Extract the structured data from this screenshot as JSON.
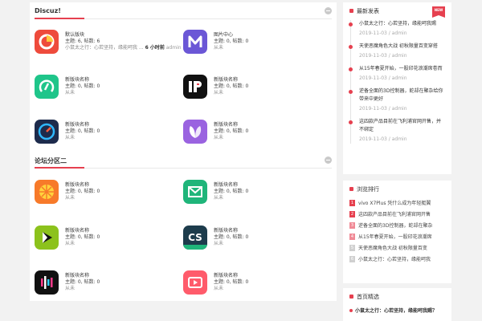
{
  "sections": [
    {
      "title": "Discuz!",
      "forums": [
        {
          "name": "默认版块",
          "stats": "主题: 6, 帖数: 6",
          "last_title": "小鼠太之行：心若坚持，缘能呵我 ...",
          "last_time": "6 小时前",
          "last_user": "admin",
          "icon": "target-icon",
          "color": "#ee4b3c"
        },
        {
          "name": "图片中心",
          "stats": "主题: 0, 帖数: 0",
          "last": "从未",
          "icon": "letter-m-icon",
          "color": "#6b57d6"
        },
        {
          "name": "新版块名称",
          "stats": "主题: 0, 帖数: 0",
          "last": "从未",
          "icon": "timer-icon",
          "color": "#1fc58a"
        },
        {
          "name": "新版块名称",
          "stats": "主题: 0, 帖数: 0",
          "last": "从未",
          "icon": "ip-logo-icon",
          "color": "#111111"
        },
        {
          "name": "新版块名称",
          "stats": "主题: 0, 帖数: 0",
          "last": "从未",
          "icon": "speedometer-icon",
          "color": "#1d2b4c"
        },
        {
          "name": "新版块名称",
          "stats": "主题: 0, 帖数: 0",
          "last": "从未",
          "icon": "leaf-icon",
          "color": "#9a63e0"
        }
      ]
    },
    {
      "title": "论坛分区二",
      "forums": [
        {
          "name": "新版块名称",
          "stats": "主题: 0, 帖数: 0",
          "last": "从未",
          "icon": "orange-slice-icon",
          "color": "#f77a2a"
        },
        {
          "name": "新版块名称",
          "stats": "主题: 0, 帖数: 0",
          "last": "从未",
          "icon": "mail-icon",
          "color": "#1fb57a"
        },
        {
          "name": "新版块名称",
          "stats": "主题: 0, 帖数: 0",
          "last": "从未",
          "icon": "play-icon",
          "color": "#8cc21c"
        },
        {
          "name": "新版块名称",
          "stats": "主题: 0, 帖数: 0",
          "last": "从未",
          "icon": "cs-logo-icon",
          "color": "#1d3c4c"
        },
        {
          "name": "新版块名称",
          "stats": "主题: 0, 帖数: 0",
          "last": "从未",
          "icon": "equalizer-icon",
          "color": "#111111"
        },
        {
          "name": "新版块名称",
          "stats": "主题: 0, 帖数: 0",
          "last": "从未",
          "icon": "video-play-icon",
          "color": "#ff5b6b"
        }
      ]
    }
  ],
  "sidebar": {
    "latest": {
      "title": "最新发表",
      "badge": "NEW",
      "items": [
        {
          "title": "小鼠太之行：心若坚持，缘能呵我赐",
          "date": "2019-11-03 / admin"
        },
        {
          "title": "天使恶魔角色大战 初秋限量百变穿搭",
          "date": "2019-11-03 / admin"
        },
        {
          "title": "从15年春夏开始，一股印花浪潮席卷而",
          "date": "2019-11-03 / admin"
        },
        {
          "title": "逆备全面的3D控制器，蛇却在聚杂给你带来中更好",
          "date": "2019-11-03 / admin"
        },
        {
          "title": "这四款产品目前在飞利浦官网开售，并不绑定",
          "date": "2019-11-03 / admin"
        }
      ]
    },
    "ranking": {
      "title": "浏览排行",
      "items": [
        {
          "num": "1",
          "title": "vivo X7Plus 凭什么成为年轻艇翼",
          "color": "#e6404f"
        },
        {
          "num": "2",
          "title": "这四款产品目前在飞利浦官网开售",
          "color": "#e6404f"
        },
        {
          "num": "3",
          "title": "逆备全面的3D控制器，蛇却在聚杂",
          "color": "#f08a96"
        },
        {
          "num": "4",
          "title": "从15年春夏开始，一股印花浪潮席",
          "color": "#f08a96"
        },
        {
          "num": "5",
          "title": "天使恶魔角色大战 初秋限量百变",
          "color": "#d0d0d0"
        },
        {
          "num": "6",
          "title": "小鼠太之行：心若坚持，缘能呵我",
          "color": "#d0d0d0"
        }
      ]
    },
    "picks": {
      "title": "首页精选",
      "items": [
        {
          "title": "小鼠太之行：心若坚持，缘能呵我赐？"
        }
      ]
    }
  },
  "colors": {
    "accent": "#e6404f",
    "page_bg": "#f2f2f2"
  }
}
